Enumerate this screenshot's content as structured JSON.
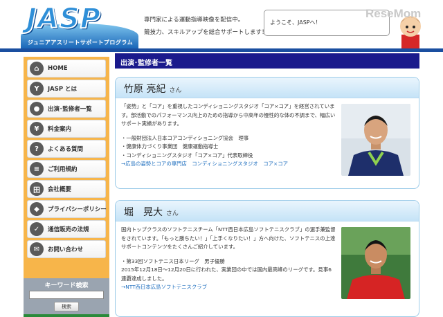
{
  "header": {
    "logo_text": "JASP",
    "logo_sub": "ジュニアアスリートサポートプログラム",
    "tagline_1": "専門家による運動指導映像を配信中。",
    "tagline_2": "競技力、スキルアップを総合サポートします！",
    "welcome": "ようこそ、JASPへ！",
    "watermark": "ReseMom"
  },
  "sidebar": {
    "items": [
      {
        "label": "HOME",
        "icon": "home-icon",
        "glyph": "⌂"
      },
      {
        "label": "JASP とは",
        "icon": "person-icon",
        "glyph": "Y"
      },
      {
        "label": "出演･監修者一覧",
        "icon": "user-icon",
        "glyph": "●"
      },
      {
        "label": "料金案内",
        "icon": "yen-icon",
        "glyph": "¥"
      },
      {
        "label": "よくある質問",
        "icon": "question-icon",
        "glyph": "?"
      },
      {
        "label": "ご利用規約",
        "icon": "rules-icon",
        "glyph": "≡"
      },
      {
        "label": "会社概要",
        "icon": "building-icon",
        "glyph": "田"
      },
      {
        "label": "プライバシーポリシー",
        "icon": "lock-icon",
        "glyph": "◆"
      },
      {
        "label": "通信販売の法規",
        "icon": "check-icon",
        "glyph": "✓"
      },
      {
        "label": "お問い合わせ",
        "icon": "mail-icon",
        "glyph": "✉"
      }
    ],
    "search_title": "キーワード検索",
    "search_button": "検索"
  },
  "main": {
    "page_title": "出演･監修者一覧",
    "cards": [
      {
        "name": "竹原 亮紀",
        "honorific": "さん",
        "desc": "「姿勢」と「コア」を重視したコンディショニングスタジオ「コア×コア」を経営されています。部活動でのパフォーマンス向上のための指導から中高年の慢性的な体の不調まで、幅広いサポート実績があります。",
        "bullets": [
          "・一般財団法人日本コアコンディショニング協会　理事",
          "・健康体力づくり事業団　健康運動指導士",
          "・コンディショニングスタジオ「コア×コア」代表取締役"
        ],
        "link": "→広島の姿勢とコアの専門店　コンディショニングスタジオ　コア×コア"
      },
      {
        "name": "堀　晃大",
        "honorific": "さん",
        "desc": "国内トップクラスのソフトテニスチーム「NTT西日本広島ソフトテニスクラブ」の選手兼監督をされています。「もっと勝ちたい！」「上手くなりたい！」方へ向けた、ソフトテニスの上達サポートコンテンツをたくさんご紹介しています。",
        "bullets": [
          "・第33回ソフトテニス日本リーグ　男子優勝",
          "2015年12月18日～12月20日に行われた、実業団の中では国内最高峰のリーグです。見事6連覇達成しました。"
        ],
        "link": "→NTT西日本広島ソフトテニスクラブ"
      }
    ]
  },
  "colors": {
    "sidebar": "#f7b54a",
    "title_bar": "#1a1a8c",
    "header_line": "#1a4fa0",
    "card_border": "#9ccbe8",
    "link": "#1f6fbf"
  }
}
